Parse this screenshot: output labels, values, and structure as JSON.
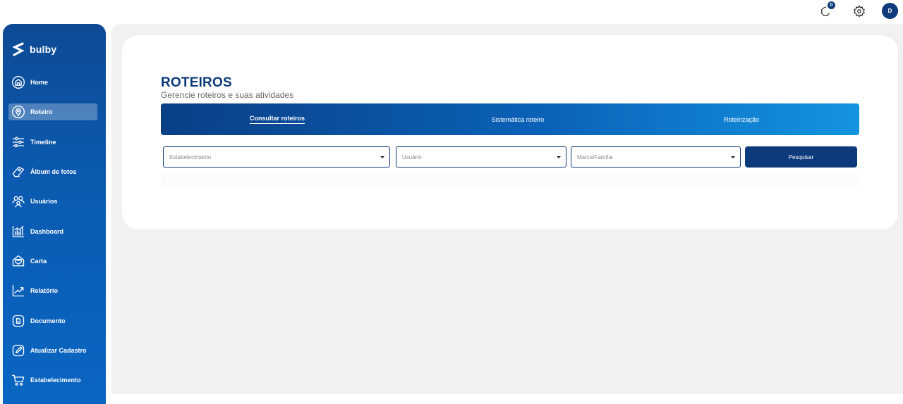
{
  "header": {
    "notification_count": "0",
    "avatar_initial": "D"
  },
  "sidebar": {
    "logo_text": "bulby",
    "items": [
      {
        "label": "Home",
        "icon": "home-icon"
      },
      {
        "label": "Roteiro",
        "icon": "location-pin-icon",
        "active": true
      },
      {
        "label": "Timeline",
        "icon": "sliders-icon"
      },
      {
        "label": "Álbum de fotos",
        "icon": "photo-album-icon"
      },
      {
        "label": "Usuários",
        "icon": "users-icon"
      },
      {
        "label": "Dashboard",
        "icon": "dashboard-chart-icon"
      },
      {
        "label": "Carta",
        "icon": "letter-icon"
      },
      {
        "label": "Relatório",
        "icon": "trend-chart-icon"
      },
      {
        "label": "Documento",
        "icon": "document-icon"
      },
      {
        "label": "Atualizar Cadastro",
        "icon": "edit-icon"
      },
      {
        "label": "Estabelecimento",
        "icon": "cart-icon"
      }
    ]
  },
  "page": {
    "title": "ROTEIROS",
    "subtitle": "Gerencie roteiros e suas atividades"
  },
  "tabs": [
    {
      "label": "Consultar roteiros",
      "active": true
    },
    {
      "label": "Sistemática roteiro"
    },
    {
      "label": "Roteirização"
    }
  ],
  "filters": {
    "estabelecimento_placeholder": "Estabelecimento",
    "usuario_placeholder": "Usuário",
    "marca_placeholder": "Marca/Família",
    "search_label": "Pesquisar"
  },
  "colors": {
    "primary": "#0d3a7a",
    "sidebar_top": "#0d4a94",
    "sidebar_bottom": "#0a66c2",
    "tab_gradient_end": "#1494e0"
  }
}
